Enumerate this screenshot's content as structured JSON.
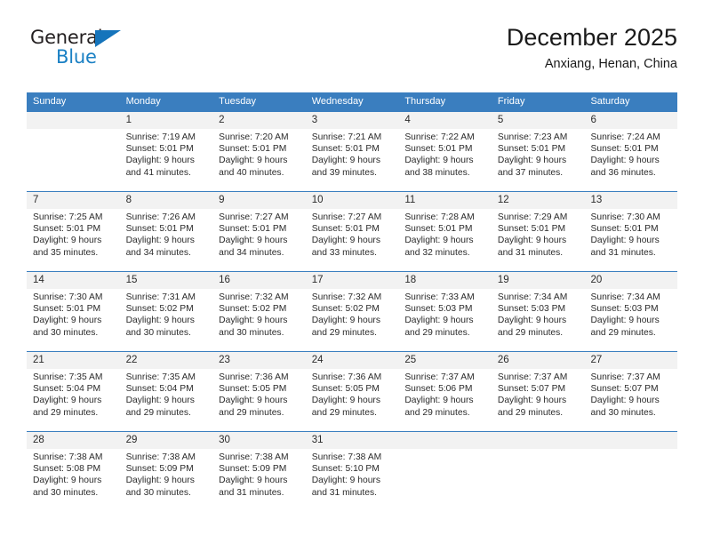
{
  "brand": {
    "name_part1": "General",
    "name_part2": "Blue",
    "triangle_icon": "triangle-icon",
    "colors": {
      "dark": "#231f20",
      "blue": "#1a80c4",
      "header": "#3a7ebf"
    }
  },
  "header": {
    "title": "December 2025",
    "location": "Anxiang, Henan, China"
  },
  "calendar": {
    "weekdays": [
      "Sunday",
      "Monday",
      "Tuesday",
      "Wednesday",
      "Thursday",
      "Friday",
      "Saturday"
    ],
    "weeks": [
      [
        {
          "day": "",
          "sunrise": "",
          "sunset": "",
          "daylight1": "",
          "daylight2": ""
        },
        {
          "day": "1",
          "sunrise": "Sunrise: 7:19 AM",
          "sunset": "Sunset: 5:01 PM",
          "daylight1": "Daylight: 9 hours",
          "daylight2": "and 41 minutes."
        },
        {
          "day": "2",
          "sunrise": "Sunrise: 7:20 AM",
          "sunset": "Sunset: 5:01 PM",
          "daylight1": "Daylight: 9 hours",
          "daylight2": "and 40 minutes."
        },
        {
          "day": "3",
          "sunrise": "Sunrise: 7:21 AM",
          "sunset": "Sunset: 5:01 PM",
          "daylight1": "Daylight: 9 hours",
          "daylight2": "and 39 minutes."
        },
        {
          "day": "4",
          "sunrise": "Sunrise: 7:22 AM",
          "sunset": "Sunset: 5:01 PM",
          "daylight1": "Daylight: 9 hours",
          "daylight2": "and 38 minutes."
        },
        {
          "day": "5",
          "sunrise": "Sunrise: 7:23 AM",
          "sunset": "Sunset: 5:01 PM",
          "daylight1": "Daylight: 9 hours",
          "daylight2": "and 37 minutes."
        },
        {
          "day": "6",
          "sunrise": "Sunrise: 7:24 AM",
          "sunset": "Sunset: 5:01 PM",
          "daylight1": "Daylight: 9 hours",
          "daylight2": "and 36 minutes."
        }
      ],
      [
        {
          "day": "7",
          "sunrise": "Sunrise: 7:25 AM",
          "sunset": "Sunset: 5:01 PM",
          "daylight1": "Daylight: 9 hours",
          "daylight2": "and 35 minutes."
        },
        {
          "day": "8",
          "sunrise": "Sunrise: 7:26 AM",
          "sunset": "Sunset: 5:01 PM",
          "daylight1": "Daylight: 9 hours",
          "daylight2": "and 34 minutes."
        },
        {
          "day": "9",
          "sunrise": "Sunrise: 7:27 AM",
          "sunset": "Sunset: 5:01 PM",
          "daylight1": "Daylight: 9 hours",
          "daylight2": "and 34 minutes."
        },
        {
          "day": "10",
          "sunrise": "Sunrise: 7:27 AM",
          "sunset": "Sunset: 5:01 PM",
          "daylight1": "Daylight: 9 hours",
          "daylight2": "and 33 minutes."
        },
        {
          "day": "11",
          "sunrise": "Sunrise: 7:28 AM",
          "sunset": "Sunset: 5:01 PM",
          "daylight1": "Daylight: 9 hours",
          "daylight2": "and 32 minutes."
        },
        {
          "day": "12",
          "sunrise": "Sunrise: 7:29 AM",
          "sunset": "Sunset: 5:01 PM",
          "daylight1": "Daylight: 9 hours",
          "daylight2": "and 31 minutes."
        },
        {
          "day": "13",
          "sunrise": "Sunrise: 7:30 AM",
          "sunset": "Sunset: 5:01 PM",
          "daylight1": "Daylight: 9 hours",
          "daylight2": "and 31 minutes."
        }
      ],
      [
        {
          "day": "14",
          "sunrise": "Sunrise: 7:30 AM",
          "sunset": "Sunset: 5:01 PM",
          "daylight1": "Daylight: 9 hours",
          "daylight2": "and 30 minutes."
        },
        {
          "day": "15",
          "sunrise": "Sunrise: 7:31 AM",
          "sunset": "Sunset: 5:02 PM",
          "daylight1": "Daylight: 9 hours",
          "daylight2": "and 30 minutes."
        },
        {
          "day": "16",
          "sunrise": "Sunrise: 7:32 AM",
          "sunset": "Sunset: 5:02 PM",
          "daylight1": "Daylight: 9 hours",
          "daylight2": "and 30 minutes."
        },
        {
          "day": "17",
          "sunrise": "Sunrise: 7:32 AM",
          "sunset": "Sunset: 5:02 PM",
          "daylight1": "Daylight: 9 hours",
          "daylight2": "and 29 minutes."
        },
        {
          "day": "18",
          "sunrise": "Sunrise: 7:33 AM",
          "sunset": "Sunset: 5:03 PM",
          "daylight1": "Daylight: 9 hours",
          "daylight2": "and 29 minutes."
        },
        {
          "day": "19",
          "sunrise": "Sunrise: 7:34 AM",
          "sunset": "Sunset: 5:03 PM",
          "daylight1": "Daylight: 9 hours",
          "daylight2": "and 29 minutes."
        },
        {
          "day": "20",
          "sunrise": "Sunrise: 7:34 AM",
          "sunset": "Sunset: 5:03 PM",
          "daylight1": "Daylight: 9 hours",
          "daylight2": "and 29 minutes."
        }
      ],
      [
        {
          "day": "21",
          "sunrise": "Sunrise: 7:35 AM",
          "sunset": "Sunset: 5:04 PM",
          "daylight1": "Daylight: 9 hours",
          "daylight2": "and 29 minutes."
        },
        {
          "day": "22",
          "sunrise": "Sunrise: 7:35 AM",
          "sunset": "Sunset: 5:04 PM",
          "daylight1": "Daylight: 9 hours",
          "daylight2": "and 29 minutes."
        },
        {
          "day": "23",
          "sunrise": "Sunrise: 7:36 AM",
          "sunset": "Sunset: 5:05 PM",
          "daylight1": "Daylight: 9 hours",
          "daylight2": "and 29 minutes."
        },
        {
          "day": "24",
          "sunrise": "Sunrise: 7:36 AM",
          "sunset": "Sunset: 5:05 PM",
          "daylight1": "Daylight: 9 hours",
          "daylight2": "and 29 minutes."
        },
        {
          "day": "25",
          "sunrise": "Sunrise: 7:37 AM",
          "sunset": "Sunset: 5:06 PM",
          "daylight1": "Daylight: 9 hours",
          "daylight2": "and 29 minutes."
        },
        {
          "day": "26",
          "sunrise": "Sunrise: 7:37 AM",
          "sunset": "Sunset: 5:07 PM",
          "daylight1": "Daylight: 9 hours",
          "daylight2": "and 29 minutes."
        },
        {
          "day": "27",
          "sunrise": "Sunrise: 7:37 AM",
          "sunset": "Sunset: 5:07 PM",
          "daylight1": "Daylight: 9 hours",
          "daylight2": "and 30 minutes."
        }
      ],
      [
        {
          "day": "28",
          "sunrise": "Sunrise: 7:38 AM",
          "sunset": "Sunset: 5:08 PM",
          "daylight1": "Daylight: 9 hours",
          "daylight2": "and 30 minutes."
        },
        {
          "day": "29",
          "sunrise": "Sunrise: 7:38 AM",
          "sunset": "Sunset: 5:09 PM",
          "daylight1": "Daylight: 9 hours",
          "daylight2": "and 30 minutes."
        },
        {
          "day": "30",
          "sunrise": "Sunrise: 7:38 AM",
          "sunset": "Sunset: 5:09 PM",
          "daylight1": "Daylight: 9 hours",
          "daylight2": "and 31 minutes."
        },
        {
          "day": "31",
          "sunrise": "Sunrise: 7:38 AM",
          "sunset": "Sunset: 5:10 PM",
          "daylight1": "Daylight: 9 hours",
          "daylight2": "and 31 minutes."
        },
        {
          "day": "",
          "sunrise": "",
          "sunset": "",
          "daylight1": "",
          "daylight2": ""
        },
        {
          "day": "",
          "sunrise": "",
          "sunset": "",
          "daylight1": "",
          "daylight2": ""
        },
        {
          "day": "",
          "sunrise": "",
          "sunset": "",
          "daylight1": "",
          "daylight2": ""
        }
      ]
    ]
  }
}
